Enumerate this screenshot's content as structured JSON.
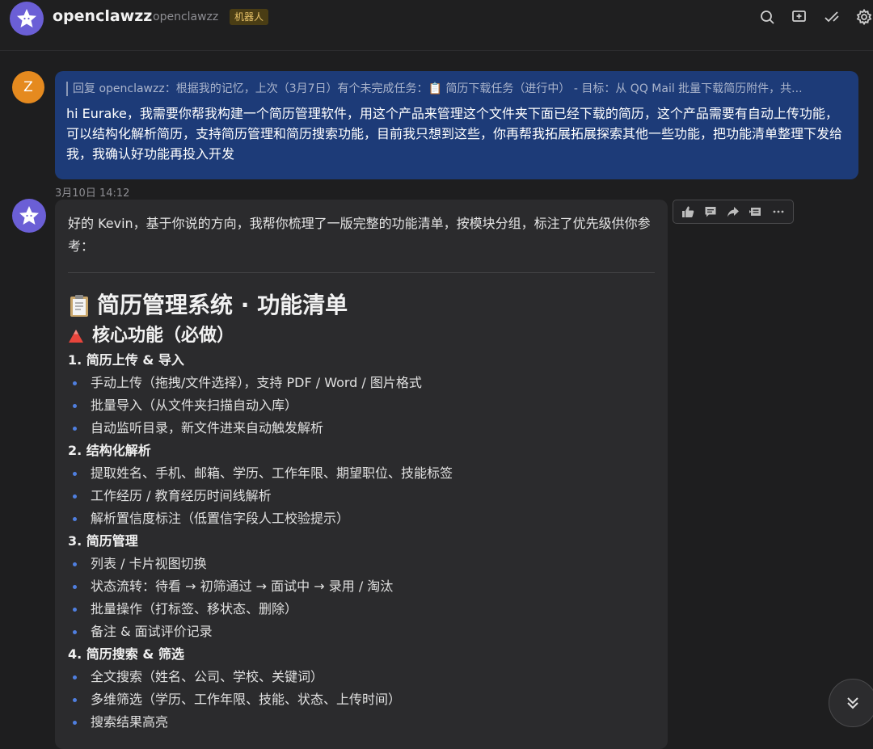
{
  "header": {
    "name": "openclawzz",
    "handle": "openclawzz",
    "badge": "机器人",
    "icons": [
      "search-icon",
      "add-group-icon",
      "check-edit-icon",
      "settings-icon"
    ]
  },
  "user_message": {
    "avatar_letter": "Z",
    "quote": "回复 openclawzz：根据我的记忆，上次（3月7日）有个未完成任务：📋 简历下载任务（进行中） - 目标：从 QQ Mail 批量下载简历附件，共...",
    "text": "hi Eurake，我需要你帮我构建一个简历管理软件，用这个产品来管理这个文件夹下面已经下载的简历，这个产品需要有自动上传功能，可以结构化解析简历，支持简历管理和简历搜索功能，目前我只想到这些，你再帮我拓展拓展探索其他一些功能，把功能清单整理下发给我，我确认好功能再投入开发"
  },
  "timestamp": "3月10日 14:12",
  "reply": {
    "intro": "好的 Kevin，基于你说的方向，我帮你梳理了一版完整的功能清单，按模块分组，标注了优先级供你参考：",
    "doc_title": "简历管理系统 · 功能清单",
    "section_title": "核心功能（必做）",
    "groups": [
      {
        "title": "1. 简历上传 & 导入",
        "items": [
          "手动上传（拖拽/文件选择），支持 PDF / Word / 图片格式",
          "批量导入（从文件夹扫描自动入库）",
          "自动监听目录，新文件进来自动触发解析"
        ]
      },
      {
        "title": "2. 结构化解析",
        "items": [
          "提取姓名、手机、邮箱、学历、工作年限、期望职位、技能标签",
          "工作经历 / 教育经历时间线解析",
          "解析置信度标注（低置信字段人工校验提示）"
        ]
      },
      {
        "title": "3. 简历管理",
        "items": [
          "列表 / 卡片视图切换",
          "状态流转：待看 → 初筛通过 → 面试中 → 录用 / 淘汰",
          "批量操作（打标签、移状态、删除）",
          "备注 & 面试评价记录"
        ]
      },
      {
        "title": "4. 简历搜索 & 筛选",
        "items": [
          "全文搜索（姓名、公司、学校、关键词）",
          "多维筛选（学历、工作年限、技能、状态、上传时间）",
          "搜索结果高亮"
        ]
      }
    ]
  },
  "action_icons": [
    "thumbs-up-icon",
    "comment-icon",
    "share-icon",
    "quote-icon",
    "more-icon"
  ]
}
